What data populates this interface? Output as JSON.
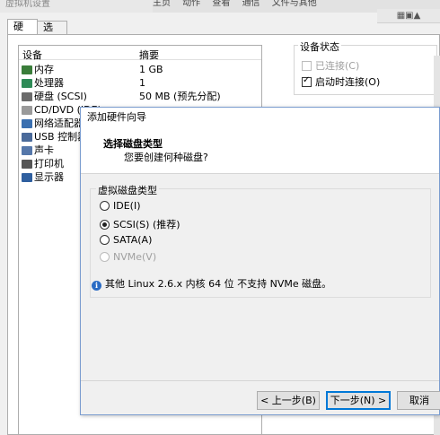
{
  "window": {
    "title": "虚拟机设置",
    "toolbar": [
      "主页",
      "动作",
      "查看",
      "通信",
      "文件与其他"
    ],
    "right_strip": "▦▣▲"
  },
  "tabs": [
    {
      "label": "硬件"
    },
    {
      "label": "选项"
    }
  ],
  "device_list": {
    "col_device": "设备",
    "col_summary": "摘要",
    "rows": [
      {
        "name": "内存",
        "summary": "1 GB",
        "icon": "memory-icon",
        "color": "#3a7d3a"
      },
      {
        "name": "处理器",
        "summary": "1",
        "icon": "cpu-icon",
        "color": "#2e8b57"
      },
      {
        "name": "硬盘 (SCSI)",
        "summary": "50 MB (预先分配)",
        "icon": "hard-disk-icon",
        "color": "#6b6b6b"
      },
      {
        "name": "CD/DVD (IDE)",
        "summary": "",
        "icon": "cd-dvd-icon",
        "color": "#9a9a9a"
      },
      {
        "name": "网络适配器",
        "summary": "",
        "icon": "network-adapter-icon",
        "color": "#3a6fb0"
      },
      {
        "name": "USB 控制器",
        "summary": "",
        "icon": "usb-controller-icon",
        "color": "#4a6a9a"
      },
      {
        "name": "声卡",
        "summary": "",
        "icon": "sound-card-icon",
        "color": "#5577aa"
      },
      {
        "name": "打印机",
        "summary": "",
        "icon": "printer-icon",
        "color": "#555555"
      },
      {
        "name": "显示器",
        "summary": "",
        "icon": "display-icon",
        "color": "#2f5f9f"
      }
    ]
  },
  "device_status": {
    "title": "设备状态",
    "connected": {
      "label": "已连接(C)",
      "checked": false,
      "enabled": false
    },
    "connect_on_power": {
      "label": "启动时连接(O)",
      "checked": true,
      "enabled": true
    }
  },
  "wizard": {
    "title": "添加硬件向导",
    "heading": "选择磁盘类型",
    "subheading": "您要创建何种磁盘?",
    "group_title": "虚拟磁盘类型",
    "options": [
      {
        "label": "IDE(I)",
        "checked": false,
        "enabled": true
      },
      {
        "label": "SCSI(S)  (推荐)",
        "checked": true,
        "enabled": true
      },
      {
        "label": "SATA(A)",
        "checked": false,
        "enabled": true
      },
      {
        "label": "NVMe(V)",
        "checked": false,
        "enabled": false
      }
    ],
    "info": "其他 Linux 2.6.x 内核 64 位 不支持 NVMe 磁盘。",
    "buttons": {
      "back": "< 上一步(B)",
      "next": "下一步(N) >",
      "cancel": "取消"
    }
  }
}
